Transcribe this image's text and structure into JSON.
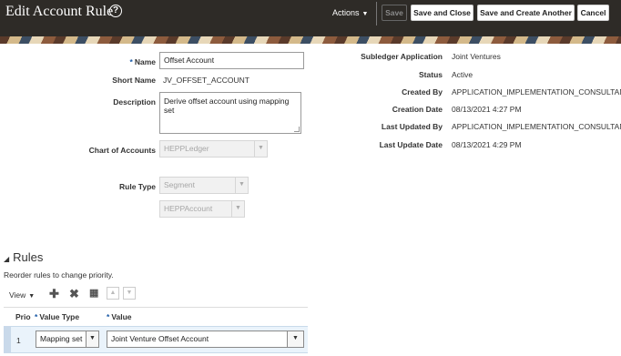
{
  "header": {
    "title": "Edit Account Rule",
    "help_glyph": "?",
    "actions_label": "Actions",
    "save_label": "Save",
    "save_close_label": "Save and Close",
    "save_create_label": "Save and Create Another",
    "cancel_label": "Cancel"
  },
  "form": {
    "name_label": "Name",
    "name_value": "Offset Account",
    "short_name_label": "Short Name",
    "short_name_value": "JV_OFFSET_ACCOUNT",
    "description_label": "Description",
    "description_value": "Derive offset account using mapping set",
    "coa_label": "Chart of Accounts",
    "coa_value": "HEPPLedger",
    "rule_type_label": "Rule Type",
    "rule_type_value": "Segment",
    "segment_value": "HEPPAccount"
  },
  "info": {
    "subledger_label": "Subledger Application",
    "subledger_value": "Joint Ventures",
    "status_label": "Status",
    "status_value": "Active",
    "created_by_label": "Created By",
    "created_by_value": "APPLICATION_IMPLEMENTATION_CONSULTANT",
    "creation_date_label": "Creation Date",
    "creation_date_value": "08/13/2021 4:27 PM",
    "updated_by_label": "Last Updated By",
    "updated_by_value": "APPLICATION_IMPLEMENTATION_CONSULTANT",
    "update_date_label": "Last Update Date",
    "update_date_value": "08/13/2021 4:29 PM"
  },
  "rules": {
    "title": "Rules",
    "hint": "Reorder rules to change priority.",
    "view_label": "View",
    "columns": {
      "priority": "Prio",
      "value_type": "Value Type",
      "value": "Value"
    },
    "rows": [
      {
        "priority": "1",
        "value_type": "Mapping set",
        "value": "Joint Venture Offset Account"
      }
    ]
  },
  "colors": {
    "header_bg": "#2e2b27",
    "accent_required": "#1a5aa6",
    "selected_row": "#eaf3fb"
  },
  "icons": {
    "add": "add-icon",
    "delete": "delete-icon",
    "freeze": "freeze-column-icon",
    "move_up": "move-up-icon",
    "move_down": "move-down-icon",
    "collapse": "collapse-triangle-icon",
    "help": "help-icon"
  }
}
